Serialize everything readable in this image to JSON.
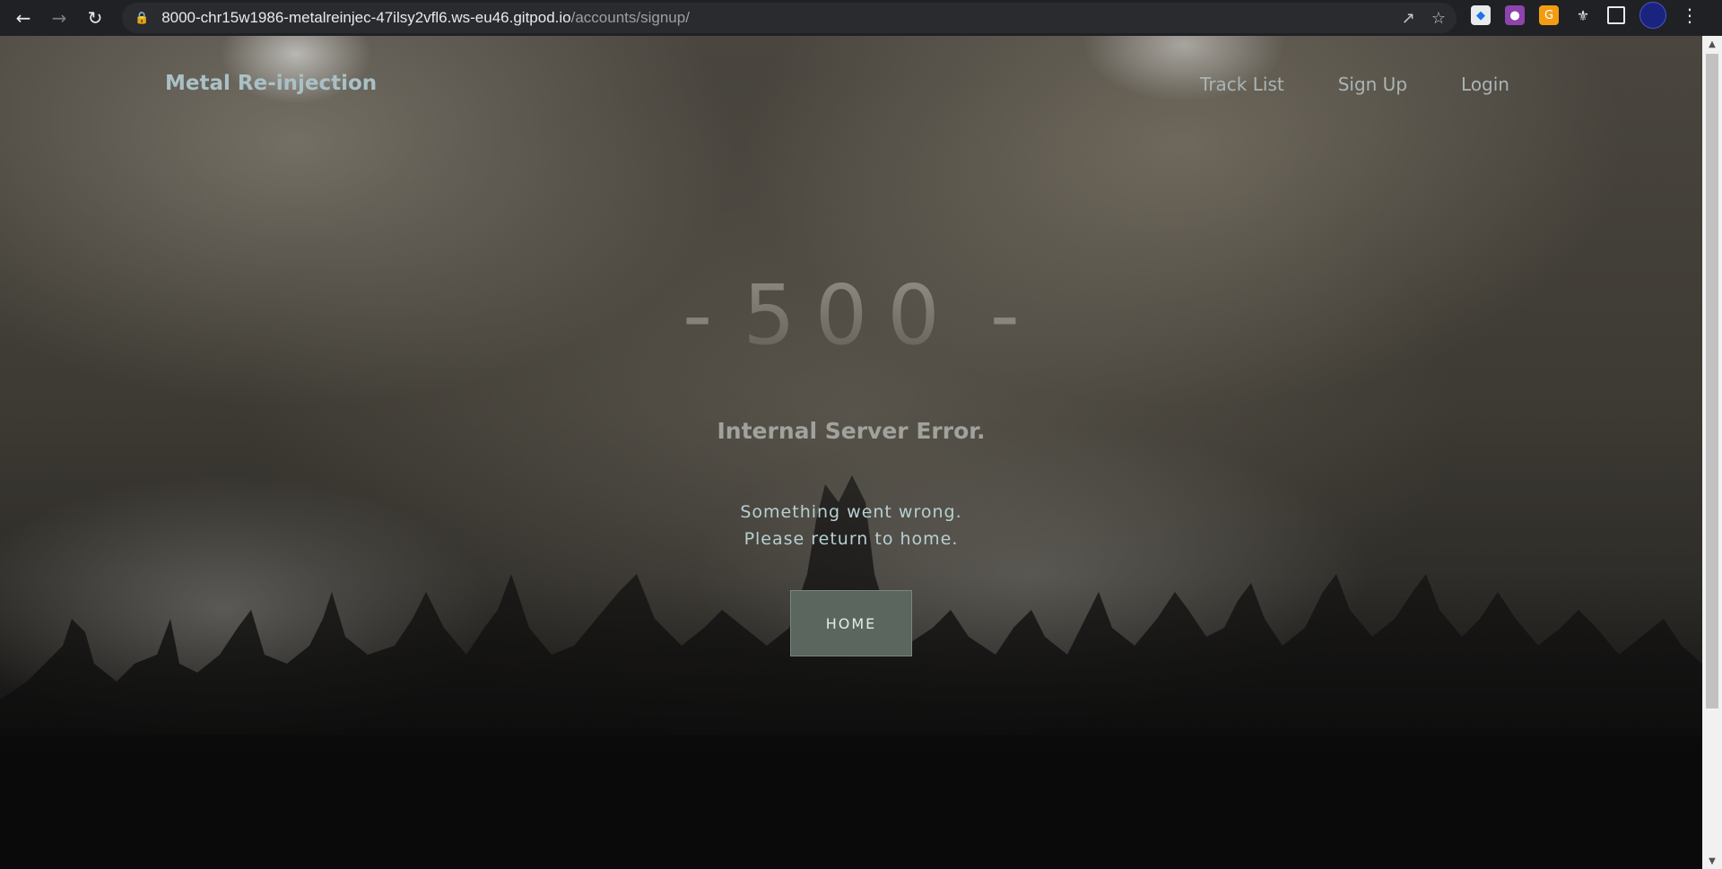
{
  "browser": {
    "back_icon": "back-arrow-icon",
    "forward_icon": "forward-arrow-icon",
    "reload_icon": "reload-icon",
    "url_host": "8000-chr15w1986-metalreinjec-47ilsy2vfl6.ws-eu46.gitpod.io",
    "url_path": "/accounts/signup/",
    "lock_icon": "lock-icon",
    "share_icon": "share-icon",
    "bookmark_icon": "star-icon",
    "extensions": [
      "extension-a-icon",
      "extension-b-icon",
      "extension-c-icon",
      "puzzle-icon",
      "side-panel-icon"
    ],
    "menu_icon": "kebab-menu-icon"
  },
  "navbar": {
    "brand": "Metal Re-injection",
    "links": [
      "Track List",
      "Sign Up",
      "Login"
    ]
  },
  "error": {
    "dash_left": "-",
    "code": "500",
    "dash_right": "-",
    "title": "Internal Server Error.",
    "message_line1": "Something went wrong.",
    "message_line2": "Please return to home.",
    "button": "HOME"
  },
  "colors": {
    "brand": "#a9c1c6",
    "nav_link": "#a9b5b5",
    "button_bg": "#5b665f",
    "message": "#b7cfd3"
  }
}
